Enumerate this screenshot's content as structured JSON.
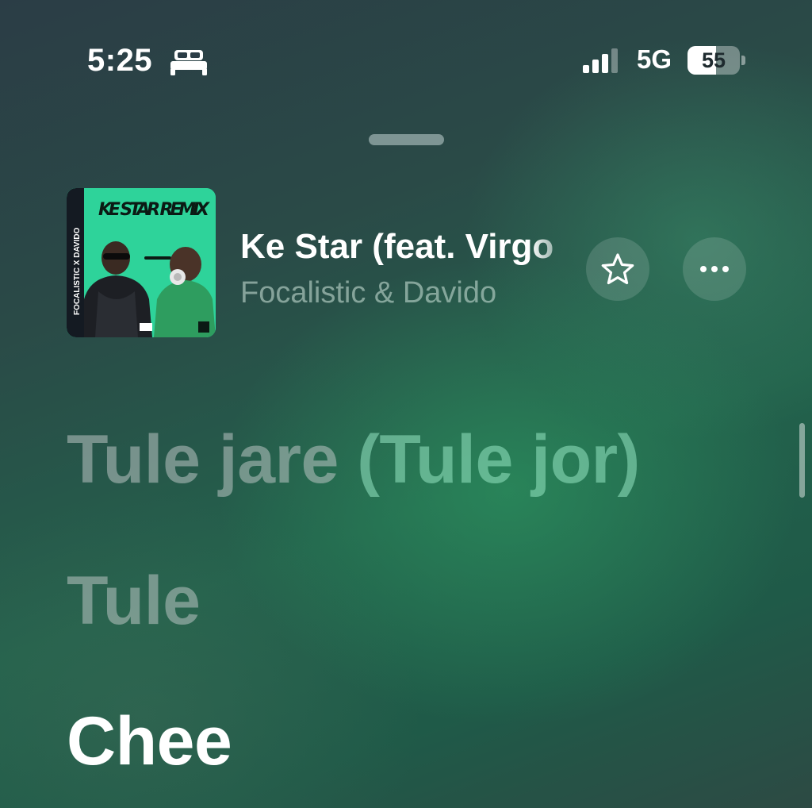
{
  "status_bar": {
    "time": "5:25",
    "focus_icon": "bed-icon",
    "signal_icon": "cellular-signal-icon",
    "signal_bars": 3,
    "network": "5G",
    "battery_level": "55",
    "battery_fraction": 0.55
  },
  "now_playing": {
    "artwork": {
      "title_text": "KE STAR REMIX",
      "side_text": "FOCALISTIC X DAVIDO"
    },
    "title": "Ke Star (feat. Virgo",
    "artist": "Focalistic & Davido",
    "favorite_icon": "star-icon",
    "more_icon": "ellipsis-icon"
  },
  "lyrics": {
    "line_1_main": "Tule jare",
    "line_1_background": "(Tule jor)",
    "line_2": "Tule",
    "line_3": "Chee"
  },
  "colors": {
    "accent_green": "#2ed39a",
    "background_dark": "#2b3d46",
    "background_green": "#23624c"
  }
}
